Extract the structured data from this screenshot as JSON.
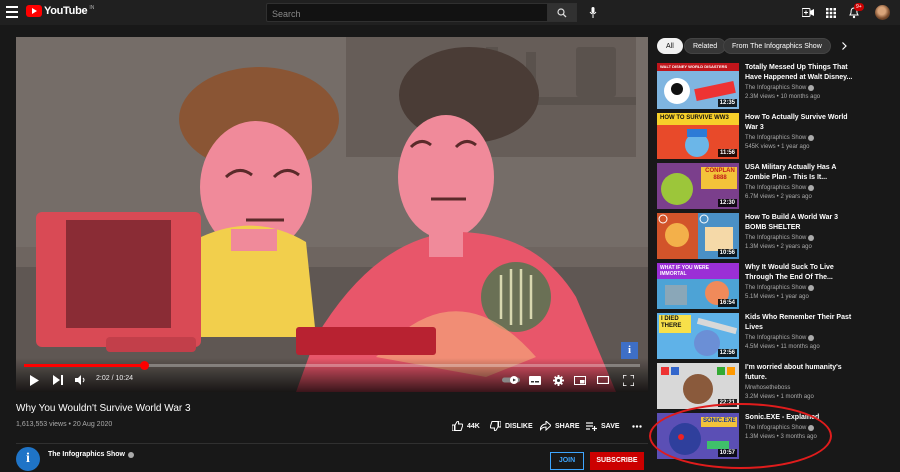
{
  "header": {
    "logo_text": "YouTube",
    "logo_sup": "IN",
    "search_placeholder": "Search",
    "notification_badge": "9+"
  },
  "player": {
    "current_time": "2:02",
    "duration": "10:24",
    "time_display": "2:02 / 10:24",
    "progress": 0.196
  },
  "video": {
    "title": "Why You Wouldn't Survive World War 3",
    "meta": "1,613,553 views • 20 Aug 2020",
    "likes": "44K",
    "dislike_label": "DISLIKE",
    "share_label": "SHARE",
    "save_label": "SAVE"
  },
  "channel": {
    "name": "The Infographics Show",
    "avatar_letter": "i",
    "join_label": "JOIN",
    "subscribe_label": "SUBSCRIBE"
  },
  "chips": [
    "All",
    "Related",
    "From The Infographics Show"
  ],
  "recommendations": [
    {
      "title": "Totally Messed Up Things That Have Happened at Walt Disney...",
      "channel": "The Infographics Show",
      "meta": "2.3M views • 10 months ago",
      "duration": "12:35",
      "thumb_text": "WALT DISNEY WORLD DISASTERS"
    },
    {
      "title": "How To Actually Survive World War 3",
      "channel": "The Infographics Show",
      "meta": "545K views • 1 year ago",
      "duration": "11:56",
      "thumb_text": "HOW TO SURVIVE WW3"
    },
    {
      "title": "USA Military Actually Has A Zombie Plan - This Is It...",
      "channel": "The Infographics Show",
      "meta": "6.7M views • 2 years ago",
      "duration": "12:30",
      "thumb_text": "CONPLAN 8888"
    },
    {
      "title": "How To Build A World War 3 BOMB SHELTER",
      "channel": "The Infographics Show",
      "meta": "1.3M views • 2 years ago",
      "duration": "10:56",
      "thumb_text": ""
    },
    {
      "title": "Why It Would Suck To Live Through The End Of The...",
      "channel": "The Infographics Show",
      "meta": "5.1M views • 1 year ago",
      "duration": "16:54",
      "thumb_text": "WHAT IF YOU WERE IMMORTAL"
    },
    {
      "title": "Kids Who Remember Their Past Lives",
      "channel": "The Infographics Show",
      "meta": "4.5M views • 11 months ago",
      "duration": "12:56",
      "thumb_text": "I DIED THERE"
    },
    {
      "title": "I'm worried about humanity's future.",
      "channel": "Mrwhosetheboss",
      "meta": "3.2M views • 1 month ago",
      "duration": "22:21",
      "thumb_text": ""
    },
    {
      "title": "Sonic.EXE - Explained",
      "channel": "The Infographics Show",
      "meta": "1.3M views • 3 months ago",
      "duration": "10:57",
      "thumb_text": "SONIC.EXE"
    }
  ],
  "colors": {
    "background": "#181818",
    "accent_red": "#ff0000",
    "highlight_ring": "#e01c1c",
    "link_blue": "#3ea6ff"
  }
}
